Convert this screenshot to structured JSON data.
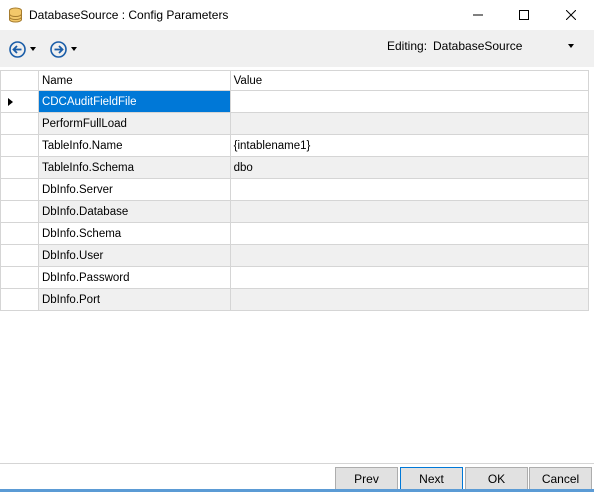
{
  "window": {
    "title": "DatabaseSource : Config Parameters",
    "icon": "database-icon"
  },
  "toolbar": {
    "editing_label": "Editing:",
    "editing_value": "DatabaseSource"
  },
  "grid": {
    "columns": [
      "Name",
      "Value"
    ],
    "rows": [
      {
        "name": "CDCAuditFieldFile",
        "value": ""
      },
      {
        "name": "PerformFullLoad",
        "value": ""
      },
      {
        "name": "TableInfo.Name",
        "value": "{intablename1}"
      },
      {
        "name": "TableInfo.Schema",
        "value": "dbo"
      },
      {
        "name": "DbInfo.Server",
        "value": ""
      },
      {
        "name": "DbInfo.Database",
        "value": ""
      },
      {
        "name": "DbInfo.Schema",
        "value": ""
      },
      {
        "name": "DbInfo.User",
        "value": ""
      },
      {
        "name": "DbInfo.Password",
        "value": ""
      },
      {
        "name": "DbInfo.Port",
        "value": ""
      }
    ]
  },
  "footer": {
    "prev_label": "Prev",
    "next_label": "Next",
    "ok_label": "OK",
    "cancel_label": "Cancel"
  },
  "colors": {
    "selection": "#0078d7",
    "alt_row": "#f0f0f0"
  }
}
